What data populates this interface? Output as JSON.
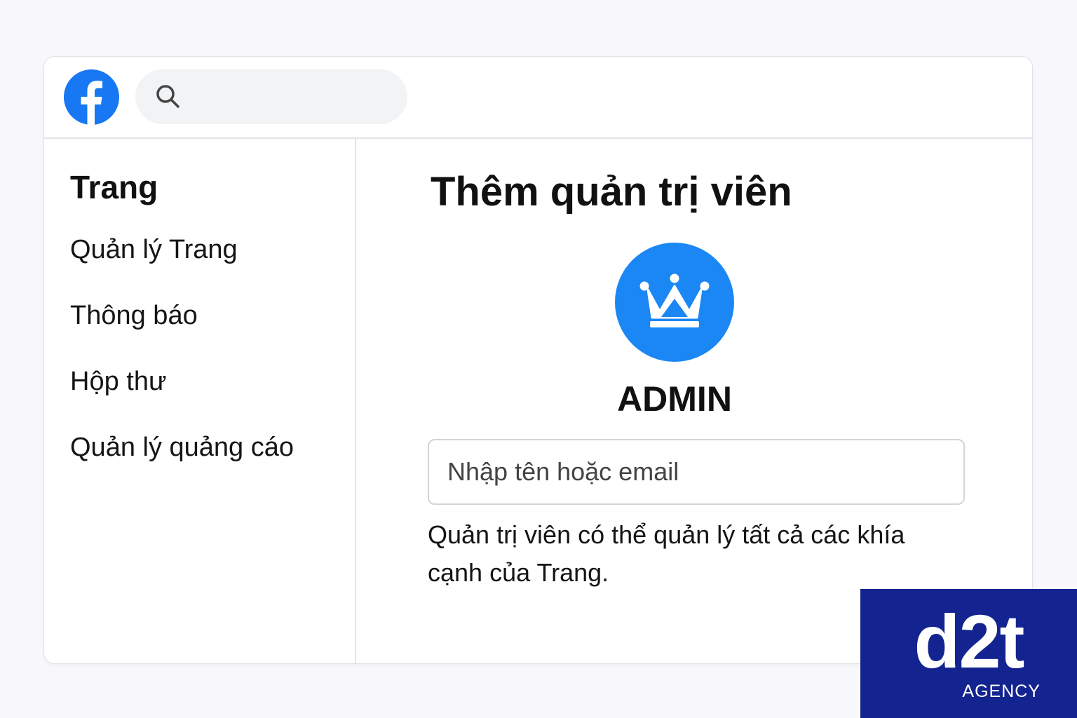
{
  "header": {
    "logo_icon": "facebook-logo-icon",
    "search_icon": "search-icon",
    "search_value": ""
  },
  "sidebar": {
    "title": "Trang",
    "items": [
      {
        "label": "Quản lý Trang"
      },
      {
        "label": "Thông báo"
      },
      {
        "label": "Hộp thư"
      },
      {
        "label": "Quản lý quảng cáo"
      }
    ]
  },
  "main": {
    "title": "Thêm quản trị viên",
    "badge_icon": "crown-icon",
    "role_label": "ADMIN",
    "input_placeholder": "Nhập tên hoặc email",
    "description": "Quản trị viên có thể quản lý tất cả các khía cạnh của Trang."
  },
  "watermark": {
    "mark": "d2t",
    "sub": "AGENCY"
  },
  "colors": {
    "facebook_blue": "#1877f2",
    "badge_blue": "#1b87f5",
    "watermark_bg": "#13238f"
  }
}
